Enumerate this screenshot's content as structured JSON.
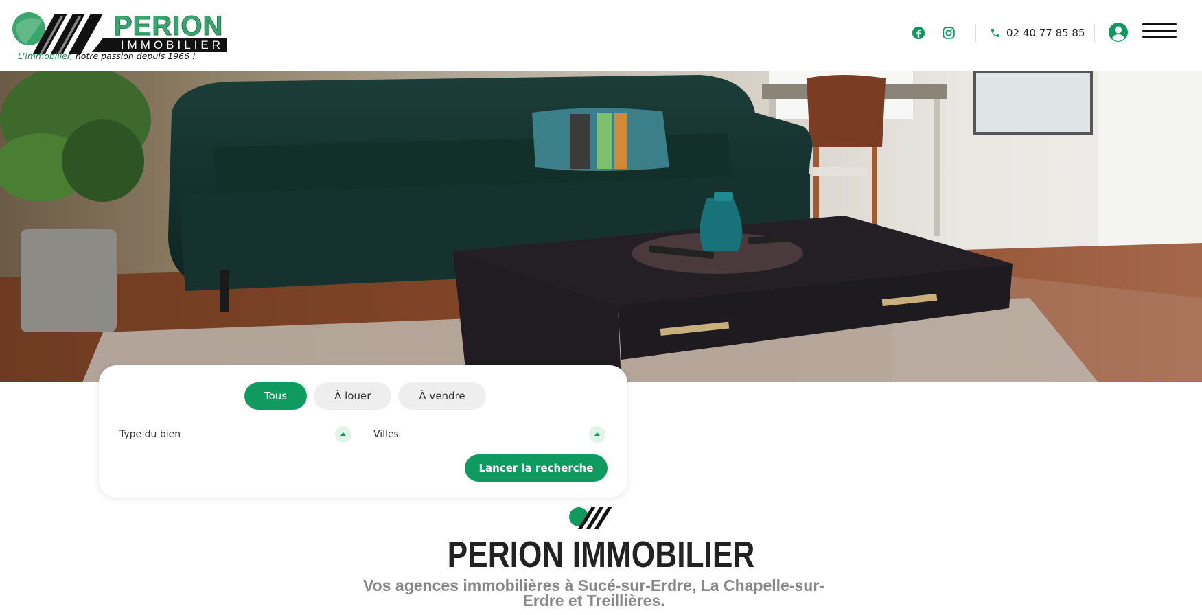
{
  "brand": {
    "name": "PERION",
    "subname": "IMMOBILIER",
    "tagline_accent": "L'immobilier,",
    "tagline_rest": " notre passion depuis 1966 !",
    "accent_color": "#0f9a60"
  },
  "header": {
    "social": [
      {
        "name": "facebook-icon"
      },
      {
        "name": "instagram-icon"
      }
    ],
    "phone": "02 40 77 85 85",
    "account_icon": "user-circle-icon",
    "menu_icon": "hamburger-menu-icon"
  },
  "hero": {
    "image": "living room with dark green sofa and coffee table"
  },
  "search": {
    "tabs": [
      {
        "label": "Tous",
        "active": true
      },
      {
        "label": "À louer",
        "active": false
      },
      {
        "label": "À vendre",
        "active": false
      }
    ],
    "type_label": "Type du bien",
    "city_label": "Villes",
    "submit_label": "Lancer la recherche"
  },
  "intro": {
    "title": "PERION IMMOBILIER",
    "subtitle": "Vos agences immobilières à Sucé-sur-Erdre, La Chapelle-sur-Erdre et Treillières."
  }
}
